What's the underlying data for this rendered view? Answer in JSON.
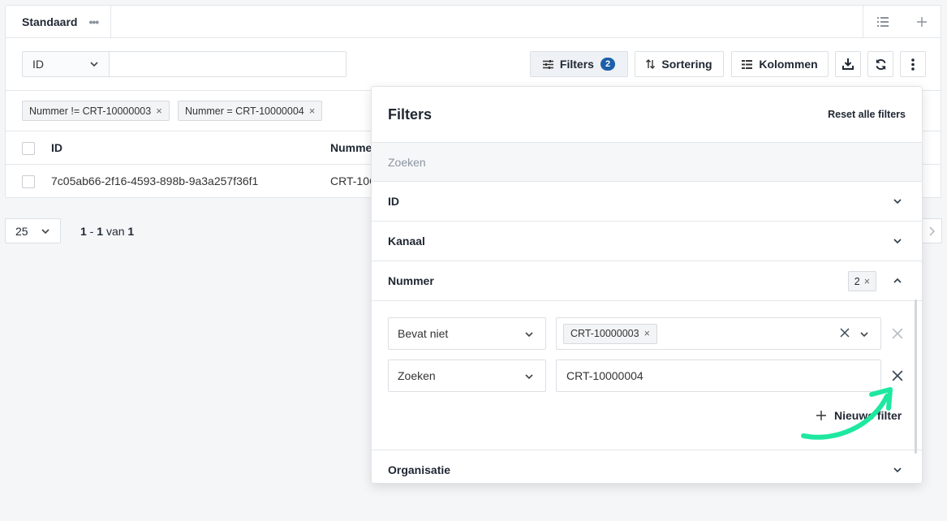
{
  "view": {
    "tab_label": "Standaard",
    "tab_menu_icon": "more-dots-icon",
    "right_icons": [
      "list-icon",
      "plus-icon"
    ]
  },
  "toolbar": {
    "field_select": "ID",
    "search_value": "",
    "filters_label": "Filters",
    "filters_count": "2",
    "sort_label": "Sortering",
    "columns_label": "Kolommen",
    "icons": [
      "download-icon",
      "refresh-icon",
      "more-vertical-icon"
    ]
  },
  "active_filters": [
    "Nummer != CRT-10000003",
    "Nummer = CRT-10000004"
  ],
  "table": {
    "headers": [
      "ID",
      "Numme"
    ],
    "rows": [
      {
        "id": "7c05ab66-2f16-4593-898b-9a3a257f36f1",
        "nummer": "CRT-10C"
      }
    ]
  },
  "pagination": {
    "page_size": "25",
    "range_start": "1",
    "range_end": "1",
    "of_word": "van",
    "total": "1"
  },
  "filter_panel": {
    "title": "Filters",
    "reset_label": "Reset alle filters",
    "search_placeholder": "Zoeken",
    "sections": {
      "id": "ID",
      "kanaal": "Kanaal",
      "nummer": "Nummer",
      "organisatie": "Organisatie"
    },
    "nummer_count": "2",
    "rules": [
      {
        "operator": "Bevat niet",
        "value_chip": "CRT-10000003"
      },
      {
        "operator": "Zoeken",
        "value": "CRT-10000004"
      }
    ],
    "new_filter_label": "Nieuwe filter"
  },
  "colors": {
    "accent": "#1d5fa8",
    "highlight_arrow": "#1ee8a0"
  }
}
